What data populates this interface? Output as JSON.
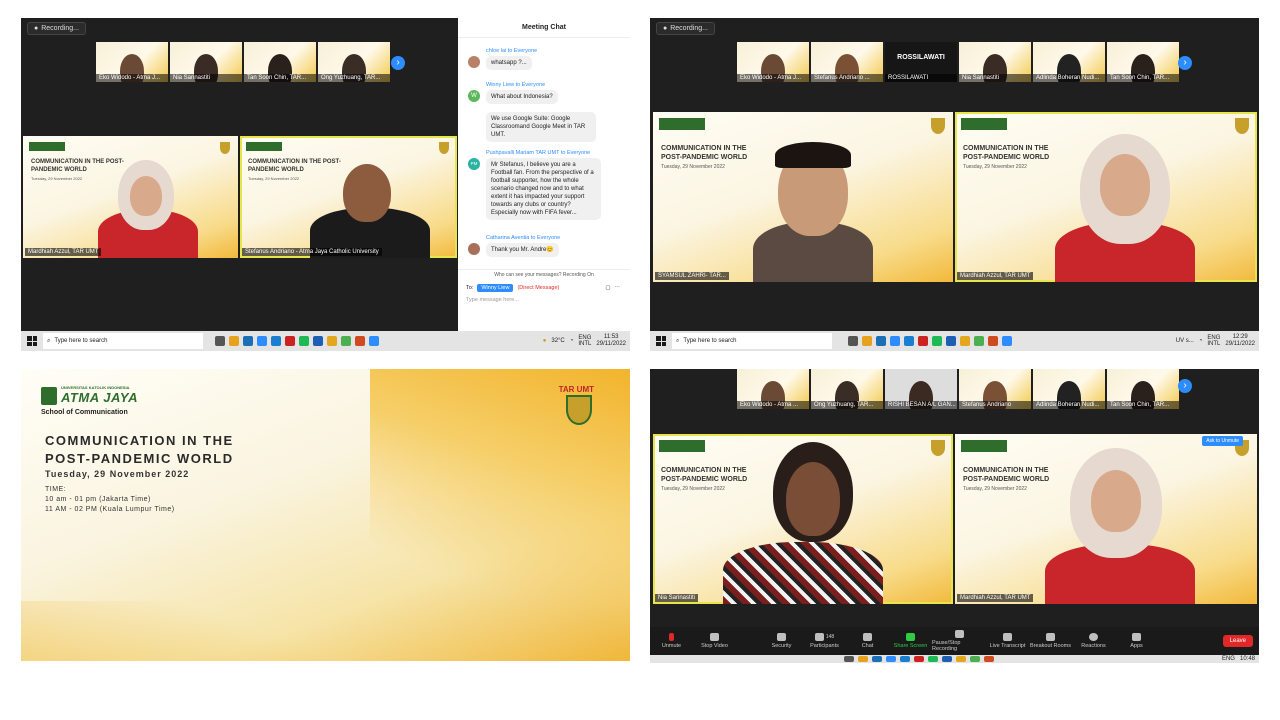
{
  "recording": "Recording...",
  "q1": {
    "thumbs": [
      "Eko Widodo - Atma J...",
      "Nia Sarinastiti",
      "Tan Soon Chin, TAR...",
      "Ong Yuzhuang, TAR..."
    ],
    "tiles": [
      "Mardhiah Azzul, TAR UMT",
      "Stefanus Andriano - Atma Jaya Catholic University"
    ],
    "slide_title": "COMMUNICATION IN THE POST-PANDEMIC WORLD",
    "slide_date": "Tuesday, 29 November 2022",
    "chat": {
      "header": "Meeting Chat",
      "m1_from": "chloe lai to Everyone",
      "m1_text": "whatsapp ?...",
      "m2_from": "Winny Liew to Everyone",
      "m2_avatar": "W",
      "m2_text": "What about Indonesia?",
      "m3_text": "We use Google Suite: Google Classroomand Google Meet in TAR UMT.",
      "m4_from": "Pushpavalli Mariam TAR UMT to Everyone",
      "m4_avatar": "PM",
      "m4_text": "Mr Stefanus, I believe you are a Football fan. From the perspective of a football supporter, how the whole scenario changed now and to what extent it has impacted your support towards any clubs or country? Especially now with FIFA fever...",
      "m5_from": "Catharina Aventia to Everyone",
      "m5_text": "Thank you Mr. Andre😊",
      "who": "Who can see your messages? Recording On",
      "to_label": "To:",
      "to_value": "Winny Liew",
      "direct": "(Direct Message)",
      "placeholder": "Type message here..."
    },
    "taskbar": {
      "search": "Type here to search",
      "temp": "32°C",
      "lang": "ENG\nINTL",
      "time": "11:53",
      "date": "29/11/2022"
    }
  },
  "q2": {
    "thumbs": [
      "Eko Widodo - Atma J...",
      "Stefanus Andriano ...",
      "ROSSILAWATI",
      "Nia Sarinastiti",
      "Adlinda Boheran Nudi...",
      "Tan Soon Chin, TAR..."
    ],
    "big_name": "ROSSILAWATI",
    "tiles": [
      "SYAMSUL ZAHRI- TAR...",
      "Mardhiah Azzul, TAR UMT"
    ],
    "taskbar": {
      "search": "Type here to search",
      "uvs": "UV s...",
      "lang": "ENG\nINTL",
      "time": "12:29",
      "date": "29/11/2022"
    }
  },
  "q3": {
    "uni": "UNIVERSITAS KATOLIK INDONESIA",
    "brand": "ATMA JAYA",
    "school": "School of Communication",
    "tarumt": "TAR UMT",
    "title1": "COMMUNICATION IN THE",
    "title2": "POST-PANDEMIC WORLD",
    "date": "Tuesday, 29 November 2022",
    "time_label": "TIME:",
    "time1": "10 am - 01 pm (Jakarta Time)",
    "time2": "11 AM - 02 PM (Kuala Lumpur Time)"
  },
  "q4": {
    "thumbs": [
      "Eko Widodo - Atma ...",
      "Ong Yuzhuang, TAR...",
      "RISHI BESAN A/L GAN...",
      "Stefanus Andriano",
      "Adlinda Boheran Nudi...",
      "Tan Soon Chin, TAR..."
    ],
    "tiles": [
      "Nia Sarinastiti",
      "Mardhiah Azzul, TAR UMT"
    ],
    "ask": "Ask to Unmute",
    "toolbar": [
      "Unmute",
      "Stop Video",
      "Security",
      "Participants",
      "Chat",
      "Share Screen",
      "Pause/Stop Recording",
      "Live Transcript",
      "Breakout Rooms",
      "Reactions",
      "Apps"
    ],
    "participants_count": "148",
    "leave": "Leave",
    "taskbar": {
      "lang": "ENG",
      "time": "10:48"
    }
  },
  "colors": {
    "zoom_bg": "#1f1f1f",
    "accent": "#2d8cff",
    "active": "#e6e64a",
    "leave": "#e02828"
  }
}
